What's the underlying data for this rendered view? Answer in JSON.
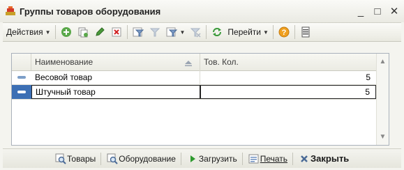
{
  "window": {
    "title": "Группы товаров оборудования"
  },
  "toolbar": {
    "actions_label": "Действия",
    "goto_label": "Перейти"
  },
  "grid": {
    "columns": [
      "Наименование",
      "Тов. Кол."
    ],
    "rows": [
      {
        "name": "Весовой товар",
        "qty": "5",
        "selected": false
      },
      {
        "name": "Штучный товар",
        "qty": "5",
        "selected": true
      }
    ]
  },
  "bottombar": {
    "goods_label": "Товары",
    "equipment_label": "Оборудование",
    "load_label": "Загрузить",
    "print_label": "Печать",
    "close_label": "Закрыть"
  },
  "colors": {
    "selection": "#3c6fb4",
    "marker": "#7d9fc8",
    "grid_border": "#a9b1bb"
  }
}
